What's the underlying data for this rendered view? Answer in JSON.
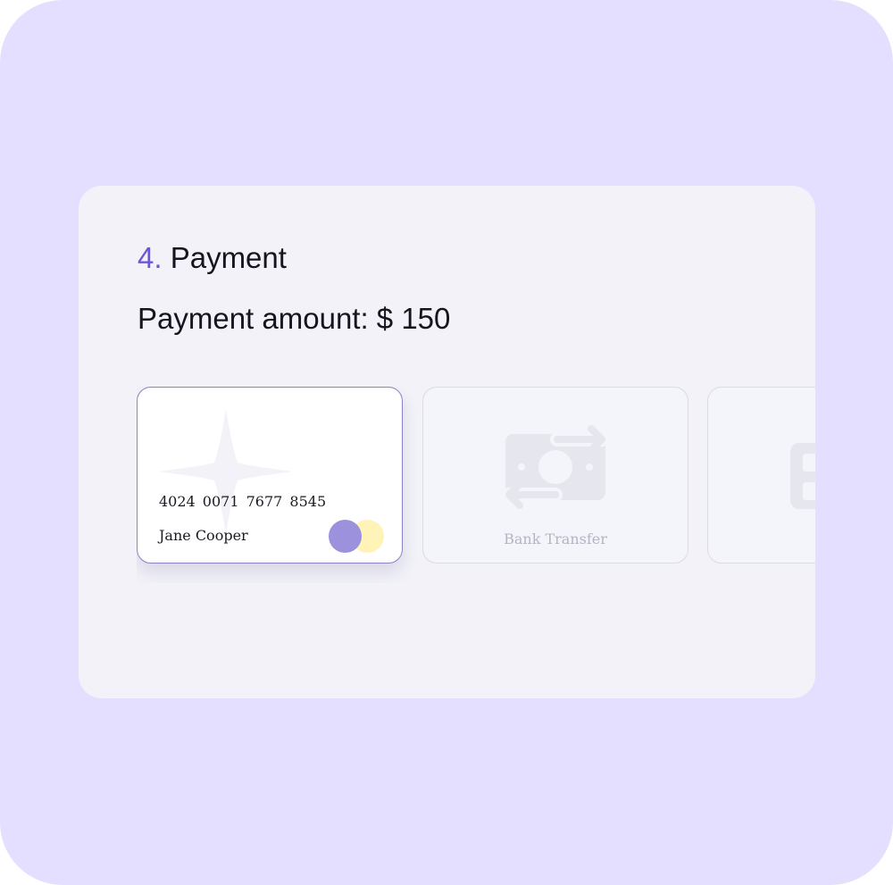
{
  "section": {
    "step_number": "4.",
    "step_title": "Payment",
    "amount_label": "Payment amount: $ 150"
  },
  "methods": {
    "card": {
      "number": "4024 0071 7677 8545",
      "holder": "Jane Cooper",
      "icon": "sparkle-icon",
      "brand_colors": [
        "#9b91dc",
        "#fff3b8"
      ]
    },
    "bank": {
      "label": "Bank Transfer",
      "icon": "money-transfer-icon"
    },
    "third": {
      "icon": "wallet-icon"
    }
  },
  "colors": {
    "background": "#e4dffe",
    "panel": "#f2f2f8",
    "accent": "#6d55d8",
    "selected_border": "#8a82c4"
  }
}
